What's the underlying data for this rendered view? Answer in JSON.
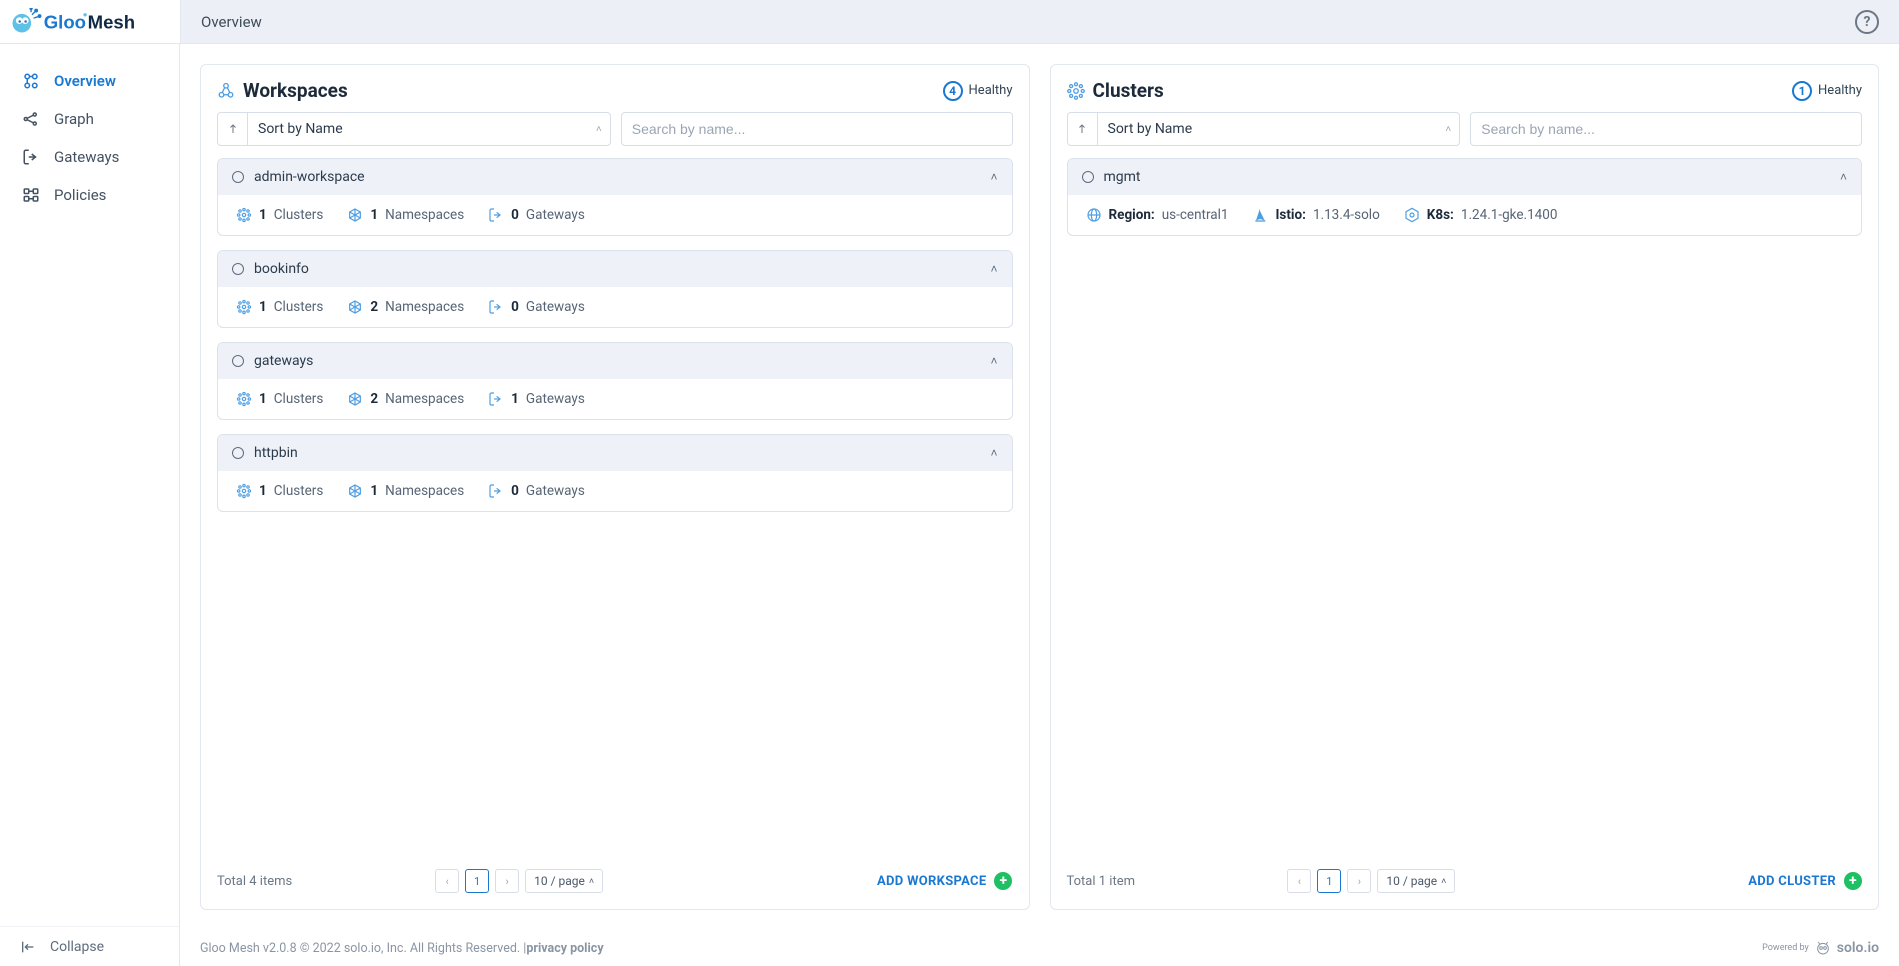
{
  "header": {
    "page_title": "Overview",
    "help_tooltip": "?"
  },
  "sidebar": {
    "items": [
      {
        "label": "Overview"
      },
      {
        "label": "Graph"
      },
      {
        "label": "Gateways"
      },
      {
        "label": "Policies"
      }
    ],
    "collapse_label": "Collapse"
  },
  "workspaces": {
    "title": "Workspaces",
    "status_count": "4",
    "status_label": "Healthy",
    "sort_label": "Sort by Name",
    "search_placeholder": "Search by name...",
    "items": [
      {
        "name": "admin-workspace",
        "clusters_count": "1",
        "clusters_label": "Clusters",
        "namespaces_count": "1",
        "namespaces_label": "Namespaces",
        "gateways_count": "0",
        "gateways_label": "Gateways"
      },
      {
        "name": "bookinfo",
        "clusters_count": "1",
        "clusters_label": "Clusters",
        "namespaces_count": "2",
        "namespaces_label": "Namespaces",
        "gateways_count": "0",
        "gateways_label": "Gateways"
      },
      {
        "name": "gateways",
        "clusters_count": "1",
        "clusters_label": "Clusters",
        "namespaces_count": "2",
        "namespaces_label": "Namespaces",
        "gateways_count": "1",
        "gateways_label": "Gateways"
      },
      {
        "name": "httpbin",
        "clusters_count": "1",
        "clusters_label": "Clusters",
        "namespaces_count": "1",
        "namespaces_label": "Namespaces",
        "gateways_count": "0",
        "gateways_label": "Gateways"
      }
    ],
    "total_text": "Total 4 items",
    "page_current": "1",
    "page_size": "10 / page",
    "add_label": "ADD WORKSPACE"
  },
  "clusters": {
    "title": "Clusters",
    "status_count": "1",
    "status_label": "Healthy",
    "sort_label": "Sort by Name",
    "search_placeholder": "Search by name...",
    "items": [
      {
        "name": "mgmt",
        "region_label": "Region:",
        "region_value": "us-central1",
        "istio_label": "Istio:",
        "istio_value": "1.13.4-solo",
        "k8s_label": "K8s:",
        "k8s_value": "1.24.1-gke.1400"
      }
    ],
    "total_text": "Total 1 item",
    "page_current": "1",
    "page_size": "10 / page",
    "add_label": "ADD CLUSTER"
  },
  "footer": {
    "copyright": "Gloo Mesh v2.0.8 © 2022 solo.io, Inc. All Rights Reserved. | ",
    "privacy_link": "privacy policy",
    "powered_label": "Powered by",
    "powered_brand": "solo.io"
  }
}
